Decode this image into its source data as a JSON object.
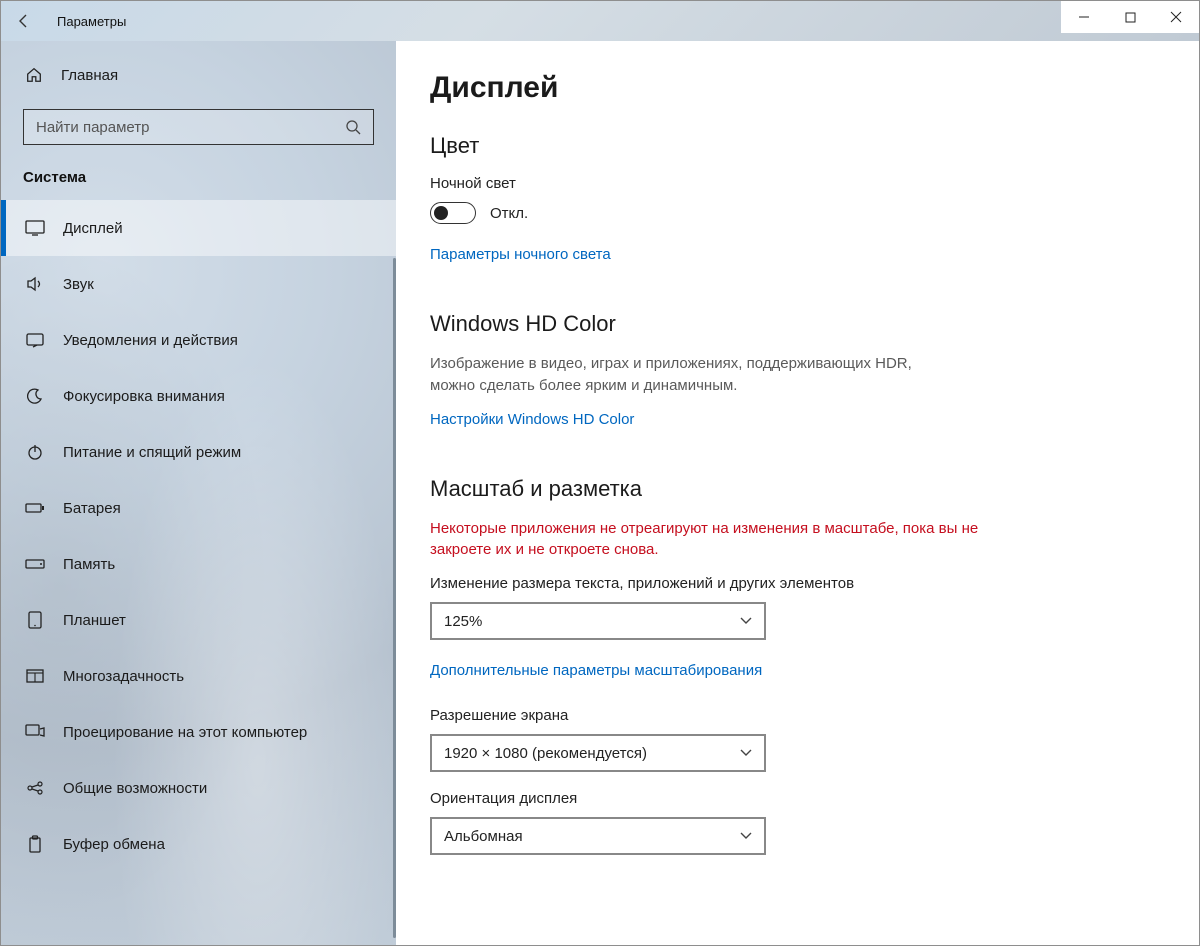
{
  "window": {
    "title": "Параметры"
  },
  "sidebar": {
    "home": "Главная",
    "search_placeholder": "Найти параметр",
    "category": "Система",
    "items": [
      {
        "label": "Дисплей"
      },
      {
        "label": "Звук"
      },
      {
        "label": "Уведомления и действия"
      },
      {
        "label": "Фокусировка внимания"
      },
      {
        "label": "Питание и спящий режим"
      },
      {
        "label": "Батарея"
      },
      {
        "label": "Память"
      },
      {
        "label": "Планшет"
      },
      {
        "label": "Многозадачность"
      },
      {
        "label": "Проецирование на этот компьютер"
      },
      {
        "label": "Общие возможности"
      },
      {
        "label": "Буфер обмена"
      }
    ]
  },
  "main": {
    "page_title": "Дисплей",
    "color_section": "Цвет",
    "night_light_label": "Ночной свет",
    "night_light_state": "Откл.",
    "night_light_link": "Параметры ночного света",
    "hd_section": "Windows HD Color",
    "hd_desc": "Изображение в видео, играх и приложениях, поддерживающих HDR, можно сделать более ярким и динамичным.",
    "hd_link": "Настройки Windows HD Color",
    "scale_section": "Масштаб и разметка",
    "scale_warning": "Некоторые приложения не отреагируют на изменения в масштабе, пока вы не закроете их и не откроете снова.",
    "scale_label": "Изменение размера текста, приложений и других элементов",
    "scale_value": "125%",
    "scale_link": "Дополнительные параметры масштабирования",
    "res_label": "Разрешение экрана",
    "res_value": "1920 × 1080 (рекомендуется)",
    "orient_label": "Ориентация дисплея",
    "orient_value": "Альбомная"
  }
}
